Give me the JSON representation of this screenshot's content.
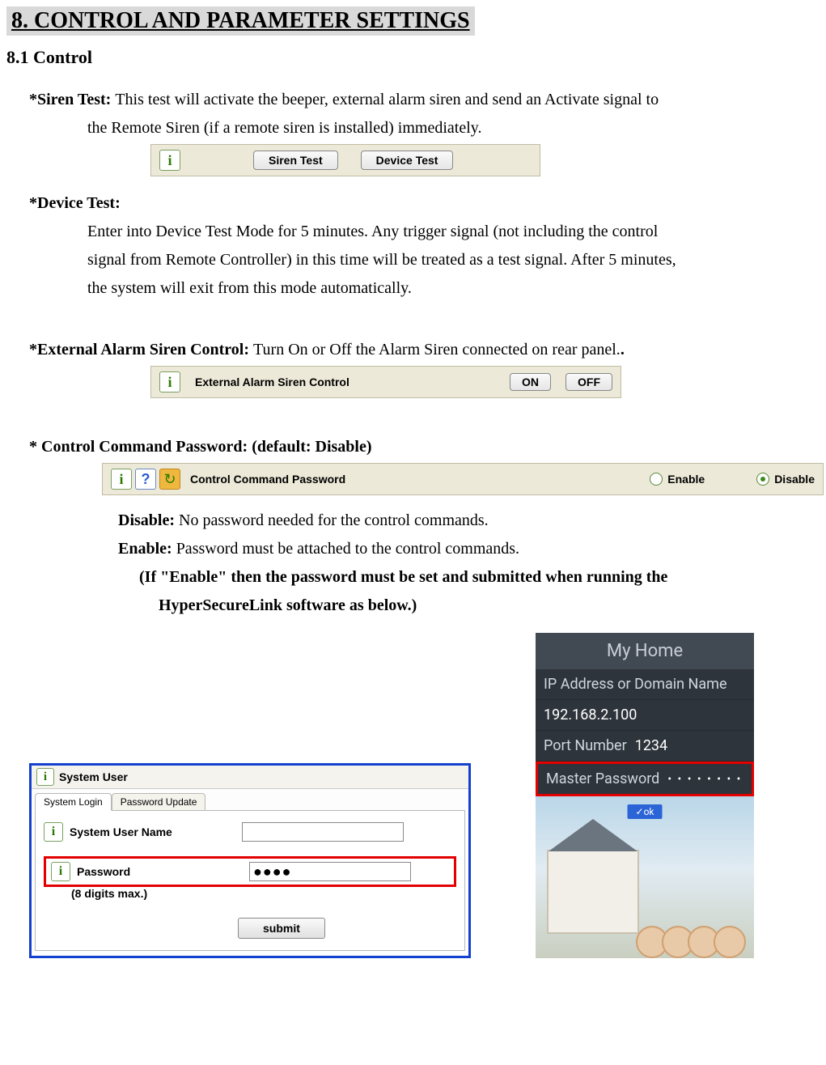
{
  "doc": {
    "heading": "8. CONTROL AND PARAMETER SETTINGS",
    "subheading": "8.1 Control",
    "siren": {
      "label": "*Siren Test: ",
      "text1": "This test will activate the beeper, external alarm siren and send an Activate signal to",
      "text2": "the Remote Siren (if a remote siren is installed) immediately."
    },
    "device": {
      "label": "*Device Test:",
      "text1": "Enter into Device Test Mode for 5 minutes. Any trigger signal (not including the control",
      "text2": "signal from Remote Controller) in this time will be treated as a test signal. After 5 minutes,",
      "text3": "the system will exit from this mode automatically."
    },
    "ext_siren": {
      "label": "*External Alarm Siren Control: ",
      "text": "Turn On or Off the Alarm Siren connected on rear panel."
    },
    "ccp": {
      "label": "* Control Command Password: (default: Disable)",
      "disable_label": "Disable: ",
      "disable_text": "No password needed for the control commands.",
      "enable_label": "Enable: ",
      "enable_text": "Password must be attached to the control commands.",
      "note1": "(If \"Enable\" then the password must be set and submitted when running the",
      "note2": "HyperSecureLink software as below.)"
    }
  },
  "panel_tests": {
    "info_glyph": "i",
    "siren_btn": "Siren Test",
    "device_btn": "Device Test"
  },
  "panel_ext_siren": {
    "info_glyph": "i",
    "label": "External Alarm Siren Control",
    "on_btn": "ON",
    "off_btn": "OFF"
  },
  "panel_ccp": {
    "info_glyph": "i",
    "help_glyph": "?",
    "refresh_glyph": "↻",
    "label": "Control Command Password",
    "enable_label": "Enable",
    "disable_label": "Disable",
    "selected": "disable"
  },
  "sysuser": {
    "info_glyph": "i",
    "title": "System User",
    "tabs": {
      "login": "System Login",
      "pwupdate": "Password Update"
    },
    "username_label": "System User Name",
    "password_label": "Password",
    "password_note": "(8 digits max.)",
    "username_value": "",
    "password_value": "●●●●",
    "submit": "submit"
  },
  "phone": {
    "title": "My Home",
    "ip_label": "IP Address or Domain Name",
    "ip_value": "192.168.2.100",
    "port_label": "Port Number",
    "port_value": "1234",
    "master_label": "Master Password",
    "master_value": "• • • • • • • •",
    "ok": "✓ok"
  }
}
